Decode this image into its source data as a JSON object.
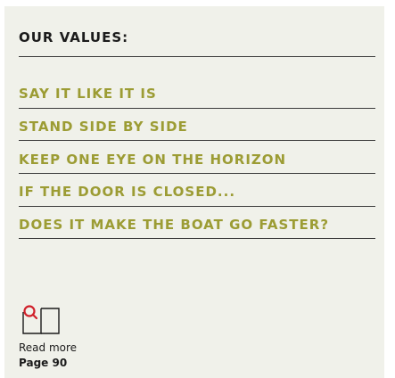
{
  "heading": "OUR VALUES:",
  "values": [
    "SAY IT LIKE IT IS",
    "STAND SIDE BY SIDE",
    "KEEP ONE EYE ON THE HORIZON",
    "IF THE DOOR IS CLOSED...",
    "DOES IT MAKE THE BOAT GO FASTER?"
  ],
  "read_more": {
    "icon": "book-magnifier-icon",
    "label": "Read more",
    "page": "Page 90"
  },
  "colors": {
    "background": "#f0f1ea",
    "heading": "#1b1b1b",
    "value_text": "#9c9c34",
    "icon_accent": "#d0202a",
    "rule": "#3a3a3a"
  }
}
